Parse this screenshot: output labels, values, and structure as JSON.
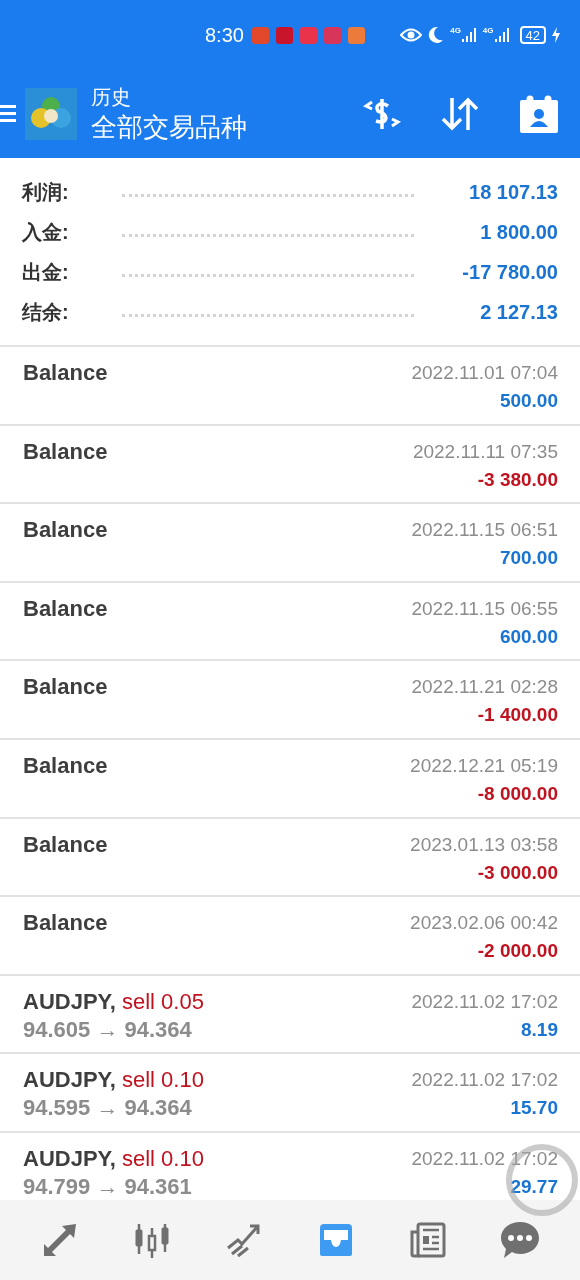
{
  "status_bar": {
    "time": "8:30",
    "networks": [
      "4G",
      "4G"
    ],
    "battery": "42"
  },
  "header": {
    "subtitle": "历史",
    "title": "全部交易品种"
  },
  "summary": [
    {
      "label": "利润:",
      "value": "18 107.13"
    },
    {
      "label": "入金:",
      "value": "1 800.00"
    },
    {
      "label": "出金:",
      "value": "-17 780.00"
    },
    {
      "label": "结余:",
      "value": "2 127.13"
    }
  ],
  "rows": [
    {
      "kind": "balance",
      "title": "Balance",
      "time": "2022.11.01 07:04",
      "amount": "500.00",
      "color": "#1a74d2"
    },
    {
      "kind": "balance",
      "title": "Balance",
      "time": "2022.11.11 07:35",
      "amount": "-3 380.00",
      "color": "#c1121f"
    },
    {
      "kind": "balance",
      "title": "Balance",
      "time": "2022.11.15 06:51",
      "amount": "700.00",
      "color": "#1a74d2"
    },
    {
      "kind": "balance",
      "title": "Balance",
      "time": "2022.11.15 06:55",
      "amount": "600.00",
      "color": "#1a74d2"
    },
    {
      "kind": "balance",
      "title": "Balance",
      "time": "2022.11.21 02:28",
      "amount": "-1 400.00",
      "color": "#c1121f"
    },
    {
      "kind": "balance",
      "title": "Balance",
      "time": "2022.12.21 05:19",
      "amount": "-8 000.00",
      "color": "#c1121f"
    },
    {
      "kind": "balance",
      "title": "Balance",
      "time": "2023.01.13 03:58",
      "amount": "-3 000.00",
      "color": "#c1121f"
    },
    {
      "kind": "balance",
      "title": "Balance",
      "time": "2023.02.06 00:42",
      "amount": "-2 000.00",
      "color": "#c1121f"
    },
    {
      "kind": "trade",
      "title": "AUDJPY,",
      "side": "sell 0.05",
      "prices": "94.605 → 94.364",
      "time": "2022.11.02 17:02",
      "amount": "8.19",
      "color": "#1a74d2"
    },
    {
      "kind": "trade",
      "title": "AUDJPY,",
      "side": "sell 0.10",
      "prices": "94.595 → 94.364",
      "time": "2022.11.02 17:02",
      "amount": "15.70",
      "color": "#1a74d2"
    },
    {
      "kind": "trade",
      "title": "AUDJPY,",
      "side": "sell 0.10",
      "prices": "94.799 → 94.361",
      "time": "2022.11.02 17:02",
      "amount": "29.77",
      "color": "#1a74d2"
    }
  ],
  "nav": [
    {
      "selected": false
    },
    {
      "selected": false
    },
    {
      "selected": false
    },
    {
      "selected": true
    },
    {
      "selected": false
    },
    {
      "selected": false
    }
  ]
}
